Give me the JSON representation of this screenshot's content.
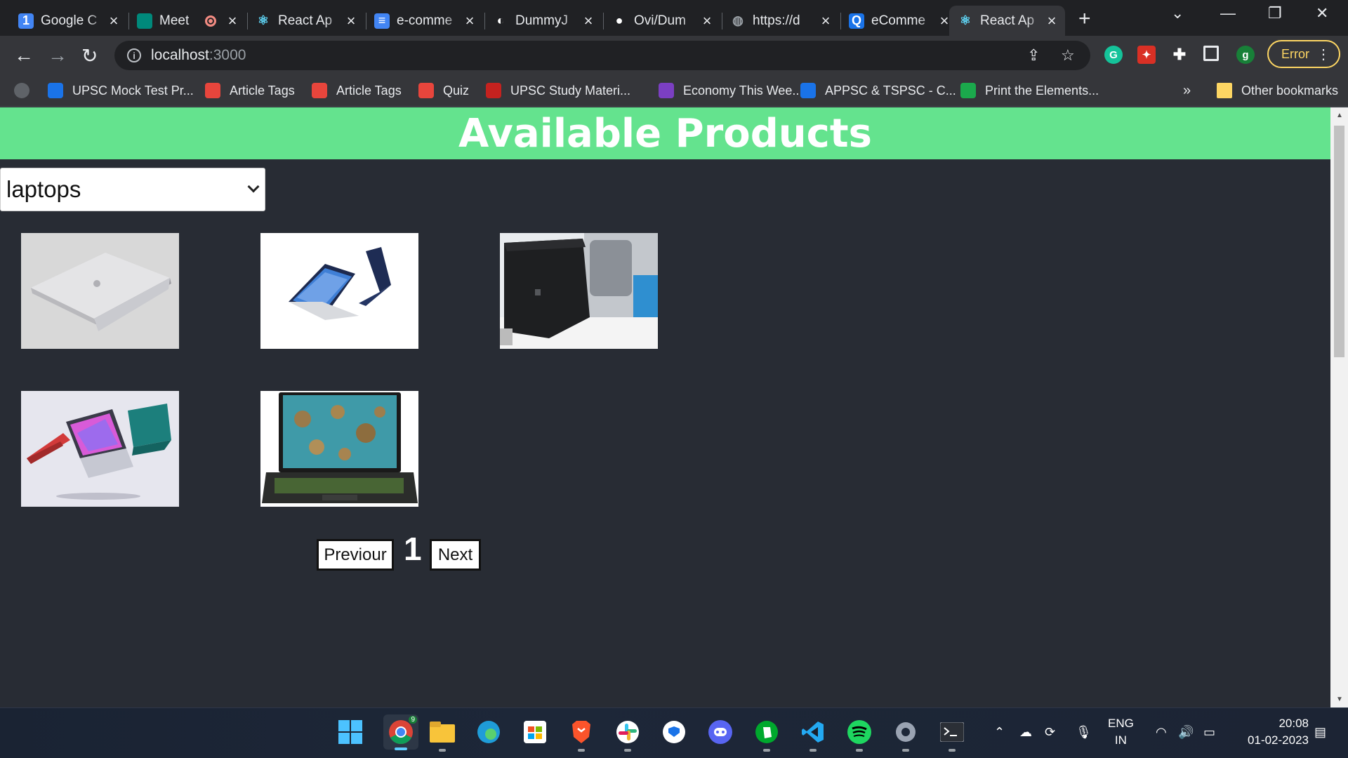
{
  "browser": {
    "tabs": [
      {
        "title": "Google C",
        "icon": "google-calendar-icon",
        "color": "#4285f4",
        "glyph": "1"
      },
      {
        "title": "Meet",
        "icon": "google-meet-icon",
        "color": "#00897b",
        "glyph": "",
        "recording": true
      },
      {
        "title": "React Ap",
        "icon": "react-icon",
        "color": "#61dafb",
        "glyph": "⚛"
      },
      {
        "title": "e-comme",
        "icon": "google-docs-icon",
        "color": "#4285f4",
        "glyph": "≡"
      },
      {
        "title": "DummyJ",
        "icon": "dummyjson-icon",
        "color": "#ffffff",
        "glyph": "◐"
      },
      {
        "title": "Ovi/Dum",
        "icon": "github-icon",
        "color": "#ffffff",
        "glyph": "●"
      },
      {
        "title": "https://d",
        "icon": "globe-icon",
        "color": "#9aa0a6",
        "glyph": "◍"
      },
      {
        "title": "eComme",
        "icon": "ecommerce-icon",
        "color": "#1a73e8",
        "glyph": "Q"
      },
      {
        "title": "React Ap",
        "icon": "react-icon",
        "color": "#61dafb",
        "glyph": "⚛",
        "active": true
      }
    ],
    "url_host": "localhost",
    "url_port": ":3000",
    "error_label": "Error",
    "profile_initial": "g",
    "bookmarks": [
      {
        "label": "",
        "icon": "globe-icon"
      },
      {
        "label": "UPSC Mock Test Pr...",
        "icon": "shield-bookmark-icon"
      },
      {
        "label": "Article Tags",
        "icon": "gfg-bookmark-icon"
      },
      {
        "label": "Article Tags",
        "icon": "gfg-bookmark-icon"
      },
      {
        "label": "Quiz",
        "icon": "gfg-bookmark-icon"
      },
      {
        "label": "UPSC Study Materi...",
        "icon": "study-bookmark-icon"
      },
      {
        "label": "Economy This Wee...",
        "icon": "b-bookmark-icon"
      },
      {
        "label": "APPSC & TSPSC - C...",
        "icon": "shield-bookmark-icon"
      },
      {
        "label": "Print the Elements...",
        "icon": "hackerrank-icon"
      }
    ],
    "more_bookmarks": "»",
    "other_bookmarks": "Other bookmarks"
  },
  "page": {
    "heading": "Available Products",
    "category_selected": "laptops",
    "products": [
      {
        "name": "silver-laptop-image",
        "style": "silver"
      },
      {
        "name": "samsung-galaxy-book-image",
        "style": "samsung"
      },
      {
        "name": "black-laptop-office-image",
        "style": "black"
      },
      {
        "name": "colorful-laptops-image",
        "style": "colorful"
      },
      {
        "name": "gaming-laptop-image",
        "style": "gaming"
      }
    ],
    "pagination": {
      "prev_label": "Previour",
      "page_number": "1",
      "next_label": "Next"
    }
  },
  "taskbar": {
    "language": "ENG",
    "region": "IN",
    "time": "20:08",
    "date": "01-02-2023",
    "chrome_badge": "9"
  }
}
